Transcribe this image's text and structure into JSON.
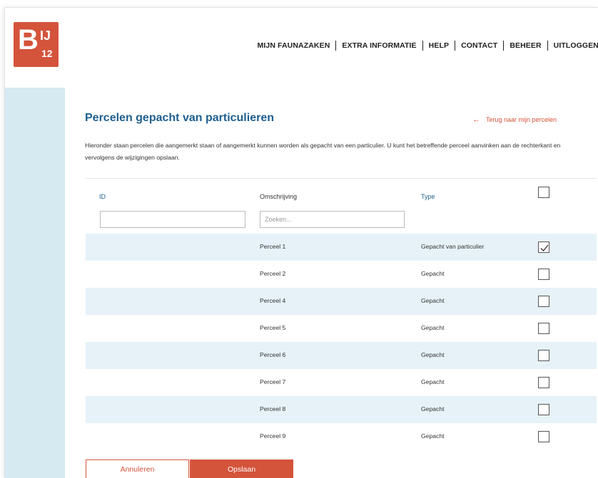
{
  "brand": {
    "logo_letter": "B",
    "logo_ij": "IJ",
    "logo_number": "12",
    "accent_color": "#d4533b",
    "primary_blue": "#1f5f8f",
    "stripe_color": "#e6f2f8",
    "sidebar_color": "#d6eaf2"
  },
  "nav": {
    "items": [
      {
        "label": "MIJN FAUNAZAKEN"
      },
      {
        "label": "EXTRA INFORMATIE"
      },
      {
        "label": "HELP"
      },
      {
        "label": "CONTACT"
      },
      {
        "label": "BEHEER"
      },
      {
        "label": "UITLOGGEN"
      }
    ]
  },
  "page": {
    "title": "Percelen gepacht van particulieren",
    "back_link": "Terug naar mijn percelen",
    "intro": "Hieronder staan percelen die aangemerkt staan of aangemerkt kunnen worden als gepacht van een particulier. U kunt het betreffende perceel aanvinken aan de rechterkant en vervolgens de wijzigingen opslaan."
  },
  "table": {
    "columns": {
      "id": "ID",
      "description": "Omschrijving",
      "type": "Type"
    },
    "filters": {
      "id_value": "",
      "description_placeholder": "Zoeken..."
    },
    "header_checked": false,
    "rows": [
      {
        "id": "",
        "description": "Perceel 1",
        "type": "Gepacht van particulier",
        "checked": true
      },
      {
        "id": "",
        "description": "Perceel 2",
        "type": "Gepacht",
        "checked": false
      },
      {
        "id": "",
        "description": "Perceel 4",
        "type": "Gepacht",
        "checked": false
      },
      {
        "id": "",
        "description": "Perceel 5",
        "type": "Gepacht",
        "checked": false
      },
      {
        "id": "",
        "description": "Perceel 6",
        "type": "Gepacht",
        "checked": false
      },
      {
        "id": "",
        "description": "Perceel 7",
        "type": "Gepacht",
        "checked": false
      },
      {
        "id": "",
        "description": "Perceel 8",
        "type": "Gepacht",
        "checked": false
      },
      {
        "id": "",
        "description": "Perceel 9",
        "type": "Gepacht",
        "checked": false
      }
    ]
  },
  "actions": {
    "cancel_label": "Annuleren",
    "save_label": "Opslaan"
  }
}
